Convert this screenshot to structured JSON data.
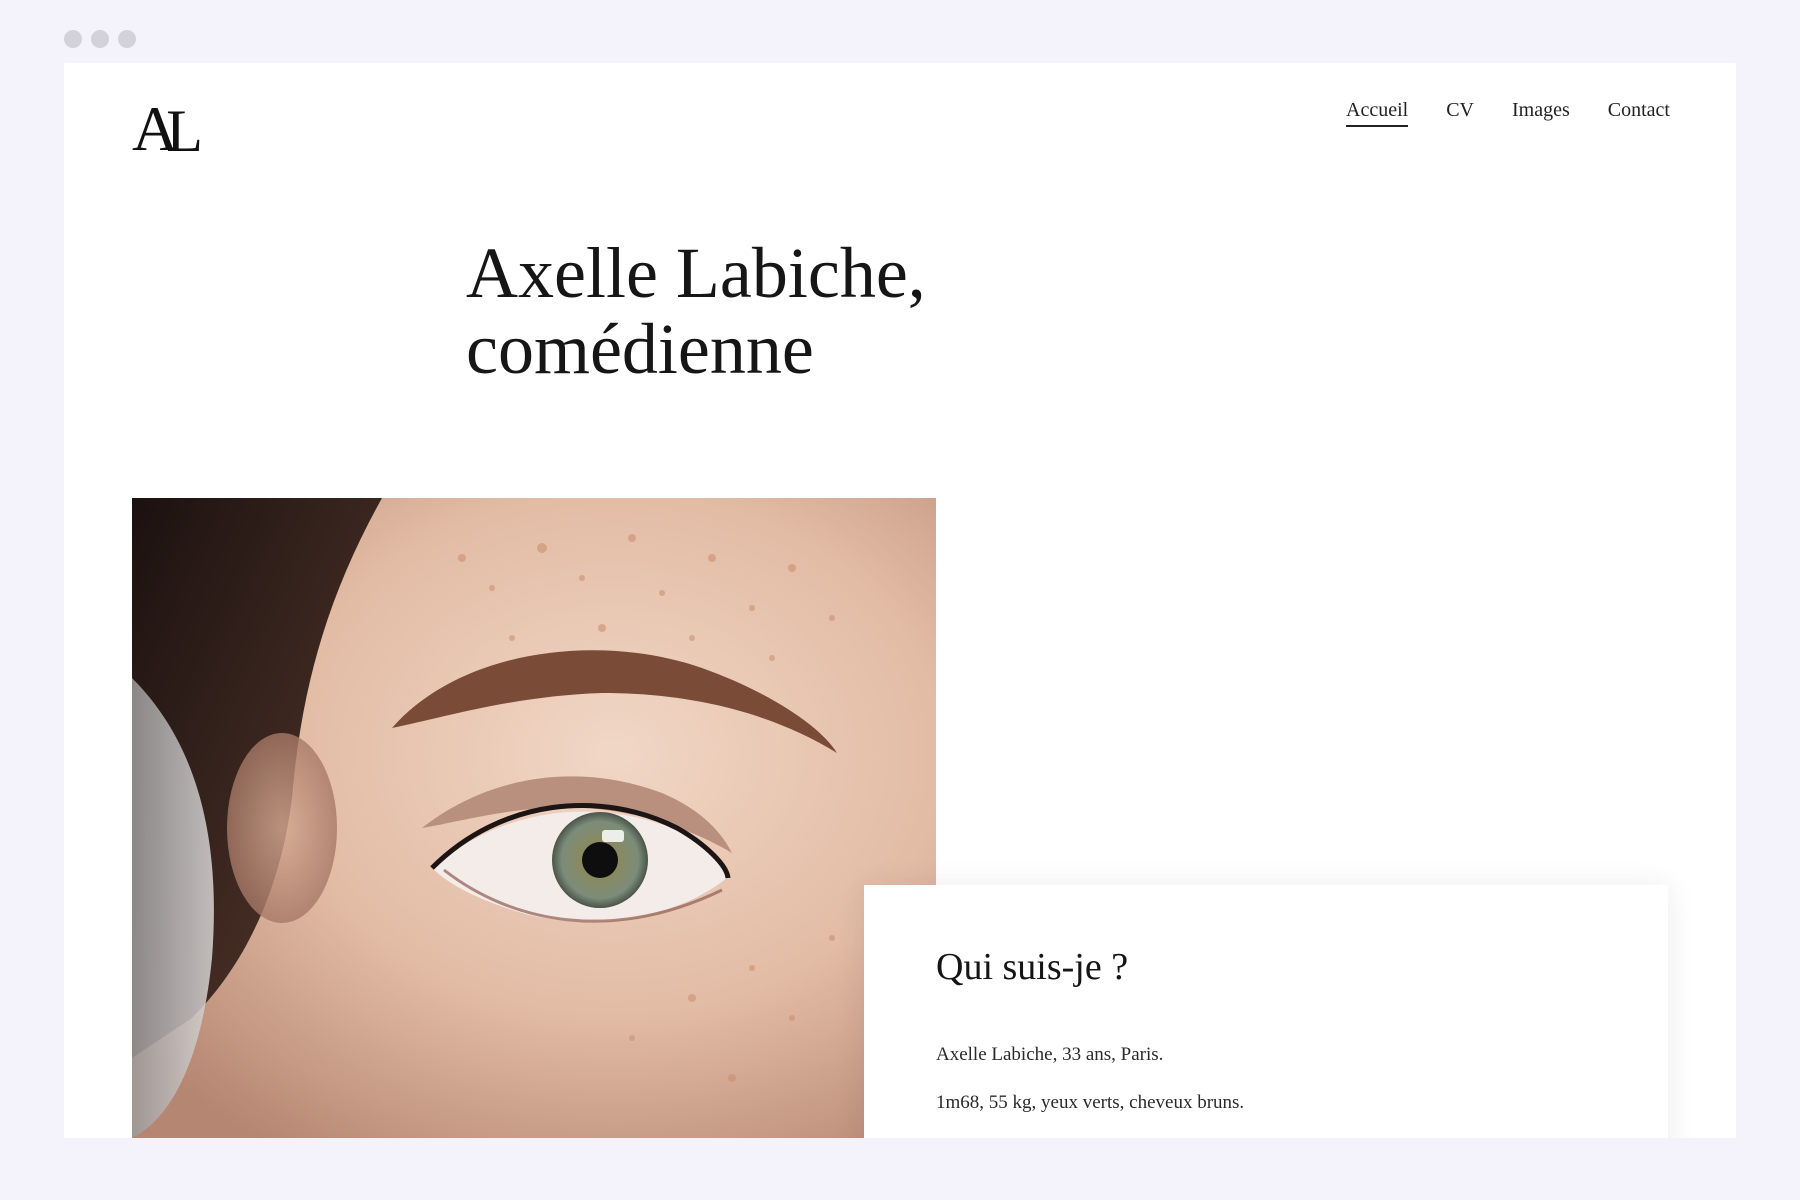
{
  "logo": {
    "first": "A",
    "second": "L"
  },
  "nav": {
    "items": [
      {
        "label": "Accueil",
        "active": true
      },
      {
        "label": "CV",
        "active": false
      },
      {
        "label": "Images",
        "active": false
      },
      {
        "label": "Contact",
        "active": false
      }
    ]
  },
  "hero": {
    "line1": "Axelle Labiche,",
    "line2": "comédienne"
  },
  "about": {
    "title": "Qui suis-je ?",
    "line1": "Axelle Labiche, 33 ans, Paris.",
    "line2": "1m68, 55 kg, yeux verts, cheveux bruns."
  }
}
